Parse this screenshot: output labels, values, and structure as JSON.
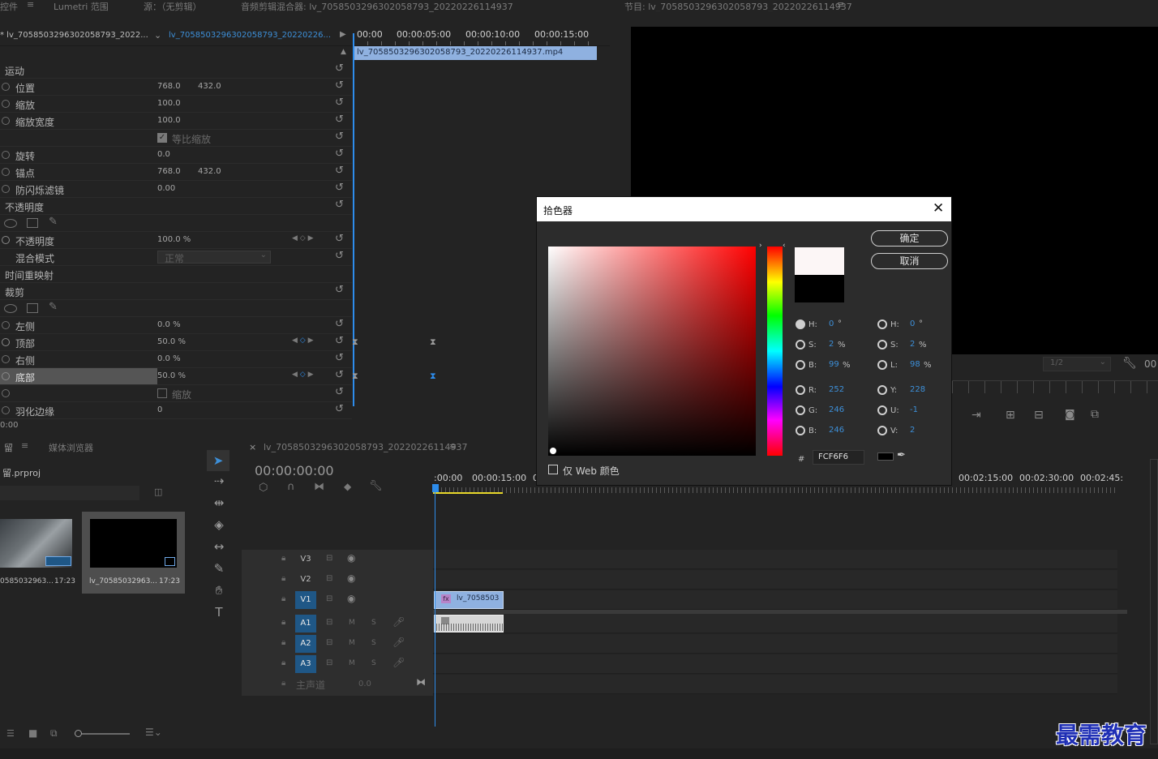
{
  "top_tabs": {
    "controls": "控件",
    "lumetri": "Lumetri 范围",
    "source": "源：（无剪辑）",
    "audio_mixer": "音频剪辑混合器: lv_7058503296302058793_20220226114937",
    "program": "节目: lv_7058503296302058793_20220226114937"
  },
  "effect_controls": {
    "source_label": "* lv_7058503296302058793_2022...",
    "sequence_label": "lv_7058503296302058793_20220226...",
    "ruler": [
      "00:00",
      "00:00:05:00",
      "00:00:10:00",
      "00:00:15:00"
    ],
    "clip_name": "lv_7058503296302058793_20220226114937.mp4",
    "motion": "运动",
    "position": {
      "label": "位置",
      "x": "768.0",
      "y": "432.0"
    },
    "scale": {
      "label": "缩放",
      "value": "100.0"
    },
    "scale_width": {
      "label": "缩放宽度",
      "value": "100.0"
    },
    "uniform_scale": "等比缩放",
    "rotation": {
      "label": "旋转",
      "value": "0.0"
    },
    "anchor": {
      "label": "锚点",
      "x": "768.0",
      "y": "432.0"
    },
    "flicker": {
      "label": "防闪烁滤镜",
      "value": "0.00"
    },
    "opacity_section": "不透明度",
    "opacity": {
      "label": "不透明度",
      "value": "100.0 %"
    },
    "blend_mode": {
      "label": "混合模式",
      "value": "正常"
    },
    "time_remap": "时间重映射",
    "crop": "裁剪",
    "left": {
      "label": "左侧",
      "value": "0.0 %"
    },
    "top": {
      "label": "顶部",
      "value": "50.0 %"
    },
    "right": {
      "label": "右侧",
      "value": "0.0 %"
    },
    "bottom": {
      "label": "底部",
      "value": "50.0 %"
    },
    "zoom": "缩放",
    "feather": {
      "label": "羽化边缘",
      "value": "0"
    },
    "footer_time": "0:00"
  },
  "program_monitor": {
    "resolution": "1/2",
    "timecode_partial": "00"
  },
  "project": {
    "tab_project": "留",
    "tab_media": "媒体浏览器",
    "file": "留.prproj",
    "items": [
      {
        "name": "0585032963...",
        "duration": "17:23"
      },
      {
        "name": "lv_70585032963...",
        "duration": "17:23"
      }
    ]
  },
  "timeline": {
    "tab": "lv_7058503296302058793_20220226114937",
    "timecode": "00:00:00:00",
    "ruler": [
      ":00:00",
      "00:00:15:00",
      "0",
      "00:02:15:00",
      "00:02:30:00",
      "00:02:45:"
    ],
    "tracks": [
      "V3",
      "V2",
      "V1",
      "A1",
      "A2",
      "A3"
    ],
    "master": {
      "label": "主声道",
      "value": "0.0"
    },
    "mute": "M",
    "solo": "S",
    "video_clip": "lv_7058503",
    "fx": "fx"
  },
  "color_picker": {
    "title": "拾色器",
    "ok": "确定",
    "cancel": "取消",
    "web_only": "仅 Web 颜色",
    "hsb": [
      {
        "label": "H:",
        "value": "0",
        "unit": "°"
      },
      {
        "label": "S:",
        "value": "2",
        "unit": "%"
      },
      {
        "label": "B:",
        "value": "99",
        "unit": "%"
      }
    ],
    "rgb": [
      {
        "label": "R:",
        "value": "252"
      },
      {
        "label": "G:",
        "value": "246"
      },
      {
        "label": "B:",
        "value": "246"
      }
    ],
    "hsl": [
      {
        "label": "H:",
        "value": "0",
        "unit": "°"
      },
      {
        "label": "S:",
        "value": "2",
        "unit": "%"
      },
      {
        "label": "L:",
        "value": "98",
        "unit": "%"
      }
    ],
    "yuv": [
      {
        "label": "Y:",
        "value": "228"
      },
      {
        "label": "U:",
        "value": "-1"
      },
      {
        "label": "V:",
        "value": "2"
      }
    ],
    "hash": "#",
    "hex": "FCF6F6",
    "new_color": "#fcf6f6",
    "old_color": "#000000"
  },
  "watermark": "最需教育",
  "colors": {
    "accent": "#2d8ceb",
    "clip_blue": "#8fb1e0",
    "watermark": "#1f2fb5"
  }
}
